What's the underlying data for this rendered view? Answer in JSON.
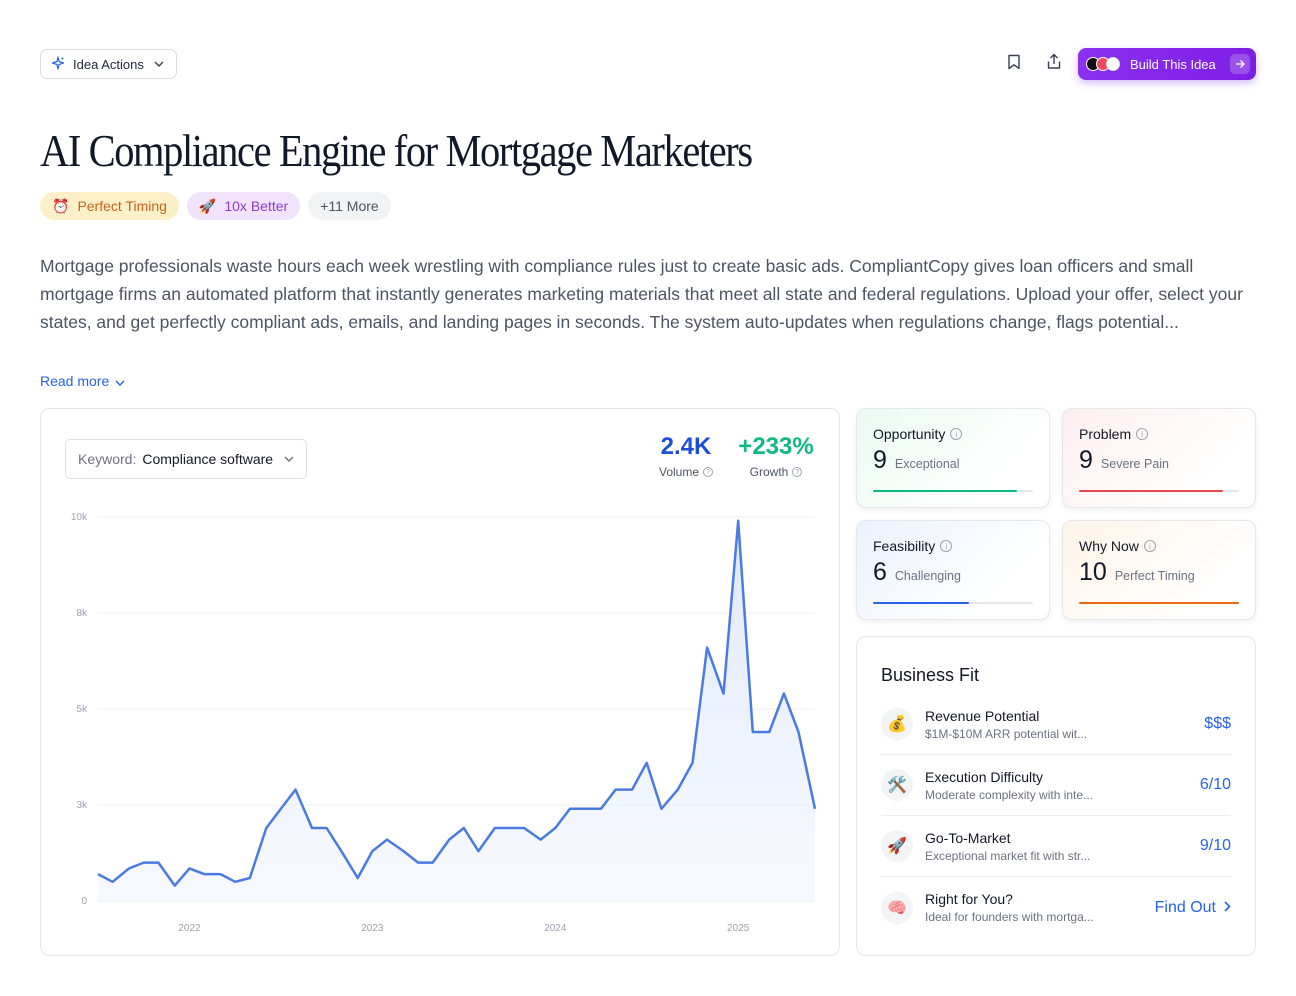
{
  "toolbar": {
    "idea_actions_label": "Idea Actions",
    "build_label": "Build This Idea"
  },
  "title": "AI Compliance Engine for Mortgage Marketers",
  "tags": [
    {
      "emoji": "⏰",
      "label": "Perfect Timing"
    },
    {
      "emoji": "🚀",
      "label": "10x Better"
    },
    {
      "label": "+11 More"
    }
  ],
  "description": "Mortgage professionals waste hours each week wrestling with compliance rules just to create basic ads. CompliantCopy gives loan officers and small mortgage firms an automated platform that instantly generates marketing materials that meet all state and federal regulations. Upload your offer, select your states, and get perfectly compliant ads, emails, and landing pages in seconds. The system auto-updates when regulations change, flags potential...",
  "read_more": "Read more",
  "keyword": {
    "label": "Keyword:",
    "value": "Compliance software"
  },
  "metrics": {
    "volume": {
      "value": "2.4K",
      "label": "Volume",
      "color": "#1d4ed8"
    },
    "growth": {
      "value": "+233%",
      "label": "Growth",
      "color": "#10b981"
    }
  },
  "chart_data": {
    "type": "area",
    "series_color": "#4a7be0",
    "y_ticks": [
      {
        "v": 0,
        "label": "0"
      },
      {
        "v": 2500,
        "label": "3k"
      },
      {
        "v": 5000,
        "label": "5k"
      },
      {
        "v": 7500,
        "label": "8k"
      },
      {
        "v": 10000,
        "label": "10k"
      }
    ],
    "x_ticks": [
      {
        "t": 2022,
        "label": "2022"
      },
      {
        "t": 2023,
        "label": "2023"
      },
      {
        "t": 2024,
        "label": "2024"
      },
      {
        "t": 2025,
        "label": "2025"
      }
    ],
    "x_range": [
      2021.5,
      2025.42
    ],
    "ylim": [
      0,
      10000
    ],
    "points": [
      [
        2021.5,
        700
      ],
      [
        2021.58,
        500
      ],
      [
        2021.67,
        850
      ],
      [
        2021.75,
        1000
      ],
      [
        2021.83,
        1000
      ],
      [
        2021.92,
        400
      ],
      [
        2022.0,
        850
      ],
      [
        2022.08,
        700
      ],
      [
        2022.17,
        700
      ],
      [
        2022.25,
        500
      ],
      [
        2022.33,
        600
      ],
      [
        2022.42,
        1900
      ],
      [
        2022.5,
        2400
      ],
      [
        2022.58,
        2900
      ],
      [
        2022.67,
        1900
      ],
      [
        2022.75,
        1900
      ],
      [
        2022.83,
        1300
      ],
      [
        2022.92,
        600
      ],
      [
        2023.0,
        1300
      ],
      [
        2023.08,
        1600
      ],
      [
        2023.17,
        1300
      ],
      [
        2023.25,
        1000
      ],
      [
        2023.33,
        1000
      ],
      [
        2023.42,
        1600
      ],
      [
        2023.5,
        1900
      ],
      [
        2023.58,
        1300
      ],
      [
        2023.67,
        1900
      ],
      [
        2023.75,
        1900
      ],
      [
        2023.83,
        1900
      ],
      [
        2023.92,
        1600
      ],
      [
        2024.0,
        1900
      ],
      [
        2024.08,
        2400
      ],
      [
        2024.17,
        2400
      ],
      [
        2024.25,
        2400
      ],
      [
        2024.33,
        2900
      ],
      [
        2024.42,
        2900
      ],
      [
        2024.5,
        3600
      ],
      [
        2024.58,
        2400
      ],
      [
        2024.67,
        2900
      ],
      [
        2024.75,
        3600
      ],
      [
        2024.83,
        6600
      ],
      [
        2024.92,
        5400
      ],
      [
        2025.0,
        9900
      ],
      [
        2025.08,
        4400
      ],
      [
        2025.17,
        4400
      ],
      [
        2025.25,
        5400
      ],
      [
        2025.33,
        4400
      ],
      [
        2025.42,
        2400
      ]
    ]
  },
  "scores": [
    {
      "title": "Opportunity",
      "value": "9",
      "label": "Exceptional",
      "fraction": 0.9,
      "color": "#10b981",
      "bg": "#eafaf2"
    },
    {
      "title": "Problem",
      "value": "9",
      "label": "Severe Pain",
      "fraction": 0.9,
      "color": "#e5484d",
      "bg": "#fdeeee"
    },
    {
      "title": "Feasibility",
      "value": "6",
      "label": "Challenging",
      "fraction": 0.6,
      "color": "#2563eb",
      "bg": "#ebf2fd"
    },
    {
      "title": "Why Now",
      "value": "10",
      "label": "Perfect Timing",
      "fraction": 1.0,
      "color": "#ea6a12",
      "bg": "#fef4e8"
    }
  ],
  "business_fit": {
    "title": "Business Fit",
    "items": [
      {
        "emoji": "💰",
        "title": "Revenue Potential",
        "sub": "$1M-$10M ARR potential wit...",
        "value": "$$$"
      },
      {
        "emoji": "🛠️",
        "title": "Execution Difficulty",
        "sub": "Moderate complexity with inte...",
        "value": "6/10"
      },
      {
        "emoji": "🚀",
        "title": "Go-To-Market",
        "sub": "Exceptional market fit with str...",
        "value": "9/10"
      },
      {
        "emoji": "🧠",
        "title": "Right for You?",
        "sub": "Ideal for founders with mortga...",
        "value": "Find Out"
      }
    ]
  }
}
